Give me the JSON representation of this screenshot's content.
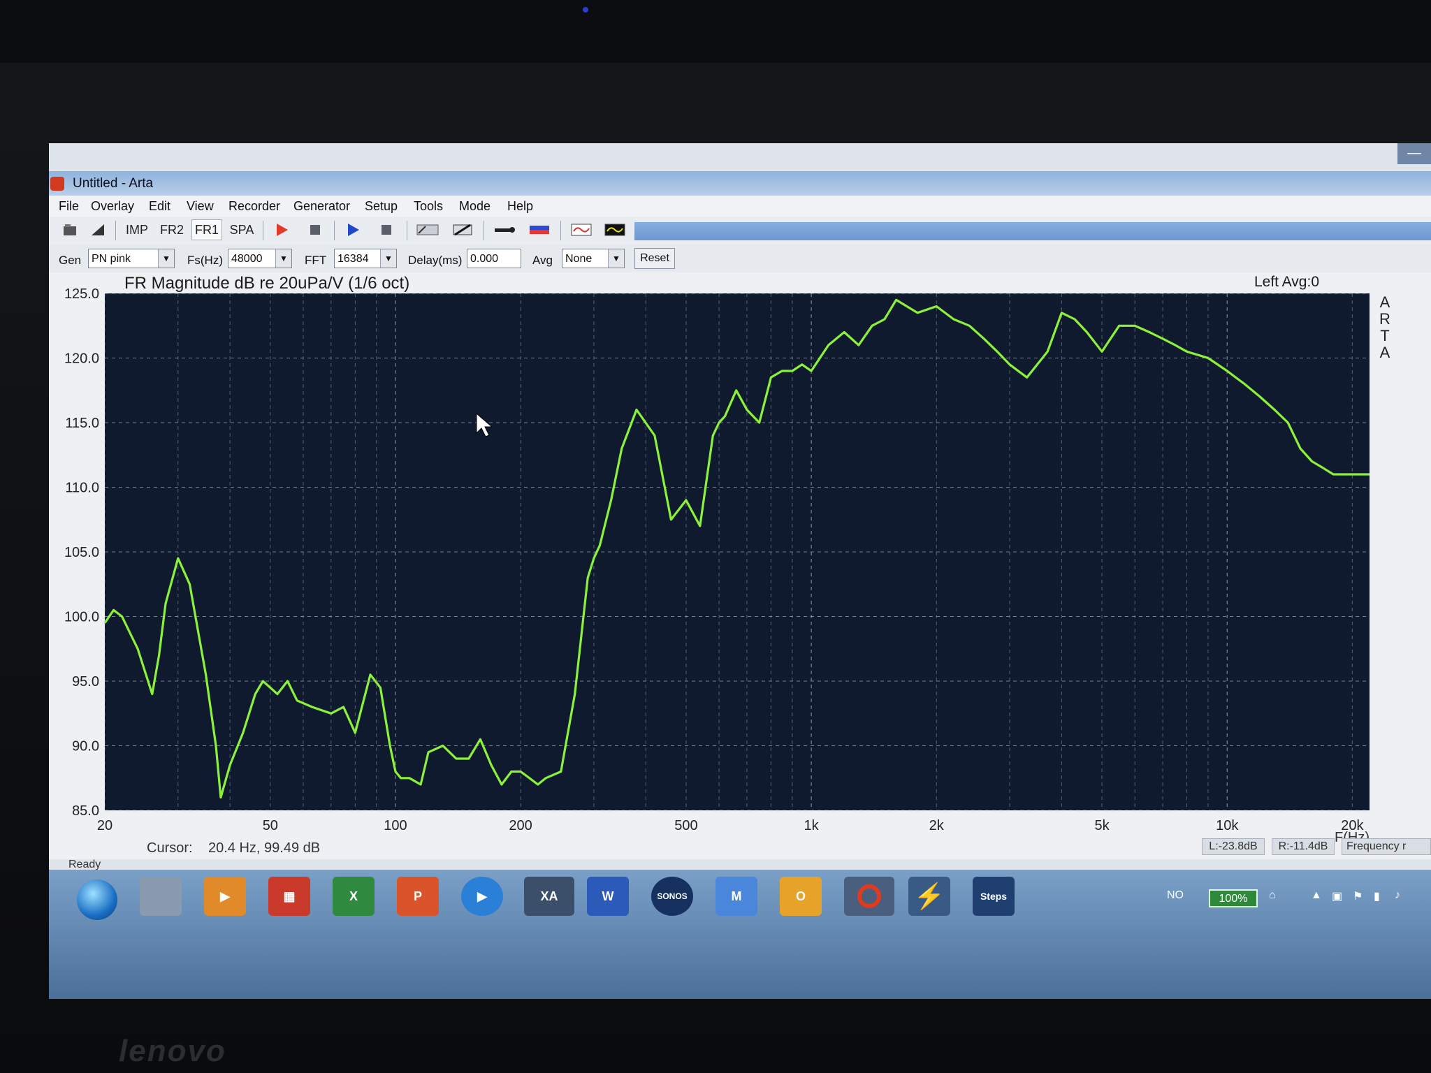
{
  "window": {
    "title": "Untitled - Arta"
  },
  "menu": [
    "File",
    "Overlay",
    "Edit",
    "View",
    "Recorder",
    "Generator",
    "Setup",
    "Tools",
    "Mode",
    "Help"
  ],
  "toolbar": {
    "imp": "IMP",
    "fr2": "FR2",
    "fr1": "FR1",
    "spa": "SPA"
  },
  "genbar": {
    "gen_label": "Gen",
    "gen_value": "PN pink",
    "fs_label": "Fs(Hz)",
    "fs_value": "48000",
    "fft_label": "FFT",
    "fft_value": "16384",
    "delay_label": "Delay(ms)",
    "delay_value": "0.000",
    "avg_label": "Avg",
    "avg_value": "None",
    "reset_label": "Reset"
  },
  "chart_data": {
    "type": "line",
    "title": "FR Magnitude dB re 20uPa/V (1/6 oct)",
    "channel_info": "Left  Avg:0",
    "brand_vertical": "ARTA",
    "xlabel": "F(Hz)",
    "x_scale": "log",
    "xlim": [
      20,
      22000
    ],
    "ylim": [
      85,
      125
    ],
    "y_ticks": [
      "125.0",
      "120.0",
      "115.0",
      "110.0",
      "105.0",
      "100.0",
      "95.0",
      "90.0",
      "85.0"
    ],
    "x_ticks": [
      {
        "value": 20,
        "label": "20"
      },
      {
        "value": 50,
        "label": "50"
      },
      {
        "value": 100,
        "label": "100"
      },
      {
        "value": 200,
        "label": "200"
      },
      {
        "value": 500,
        "label": "500"
      },
      {
        "value": 1000,
        "label": "1k"
      },
      {
        "value": 2000,
        "label": "2k"
      },
      {
        "value": 5000,
        "label": "5k"
      },
      {
        "value": 10000,
        "label": "10k"
      },
      {
        "value": 20000,
        "label": "20k"
      }
    ],
    "grid": true,
    "series_color": "#8cf13a",
    "series": [
      {
        "x": [
          20,
          21,
          22,
          24,
          26,
          27,
          28,
          30,
          32,
          35,
          37,
          38,
          40,
          43,
          46,
          48,
          52,
          55,
          58,
          63,
          70,
          75,
          80,
          87,
          92,
          97,
          100,
          103,
          108,
          115,
          120,
          130,
          140,
          150,
          160,
          170,
          180,
          190,
          200,
          210,
          220,
          230,
          250,
          270,
          290,
          300,
          310,
          330,
          350,
          380,
          420,
          460,
          500,
          540,
          580,
          600,
          620,
          660,
          700,
          750,
          800,
          850,
          900,
          950,
          1000,
          1100,
          1200,
          1300,
          1400,
          1500,
          1600,
          1800,
          2000,
          2200,
          2400,
          2600,
          2800,
          3000,
          3300,
          3700,
          4000,
          4300,
          4600,
          5000,
          5500,
          6000,
          6500,
          7000,
          7500,
          8000,
          9000,
          10000,
          11000,
          12000,
          13000,
          14000,
          15000,
          16000,
          17000,
          18000,
          19000,
          20000,
          21000,
          22000
        ],
        "y": [
          99.5,
          100.5,
          100.0,
          97.5,
          94.0,
          97.0,
          101.0,
          104.5,
          102.5,
          95.5,
          90.0,
          86.0,
          88.5,
          91.0,
          94.0,
          95.0,
          94.0,
          95.0,
          93.5,
          93.0,
          92.5,
          93.0,
          91.0,
          95.5,
          94.5,
          90.0,
          88.0,
          87.5,
          87.5,
          87.0,
          89.5,
          90.0,
          89.0,
          89.0,
          90.5,
          88.5,
          87.0,
          88.0,
          88.0,
          87.5,
          87.0,
          87.5,
          88.0,
          94.0,
          103.0,
          104.5,
          105.5,
          109.0,
          113.0,
          116.0,
          114.0,
          107.5,
          109.0,
          107.0,
          114.0,
          115.0,
          115.5,
          117.5,
          116.0,
          115.0,
          118.5,
          119.0,
          119.0,
          119.5,
          119.0,
          121.0,
          122.0,
          121.0,
          122.5,
          123.0,
          124.5,
          123.5,
          124.0,
          123.0,
          122.5,
          121.5,
          120.5,
          119.5,
          118.5,
          120.5,
          123.5,
          123.0,
          122.0,
          120.5,
          122.5,
          122.5,
          122.0,
          121.5,
          121.0,
          120.5,
          120.0,
          119.0,
          118.0,
          117.0,
          116.0,
          115.0,
          113.0,
          112.0,
          111.5,
          111.0,
          111.0,
          111.0,
          111.0,
          111.0
        ]
      }
    ]
  },
  "cursor": {
    "label": "Cursor:",
    "value": "20.4 Hz, 99.49 dB"
  },
  "status": {
    "ready": "Ready",
    "left_level": "L:-23.8dB",
    "right_level": "R:-11.4dB",
    "mode": "Frequency r"
  },
  "taskbar": {
    "steps_label": "Steps",
    "lang": "NO",
    "battery": "100%",
    "sonos_label": "SONOS"
  },
  "brand": {
    "laptop": "lenovo"
  }
}
